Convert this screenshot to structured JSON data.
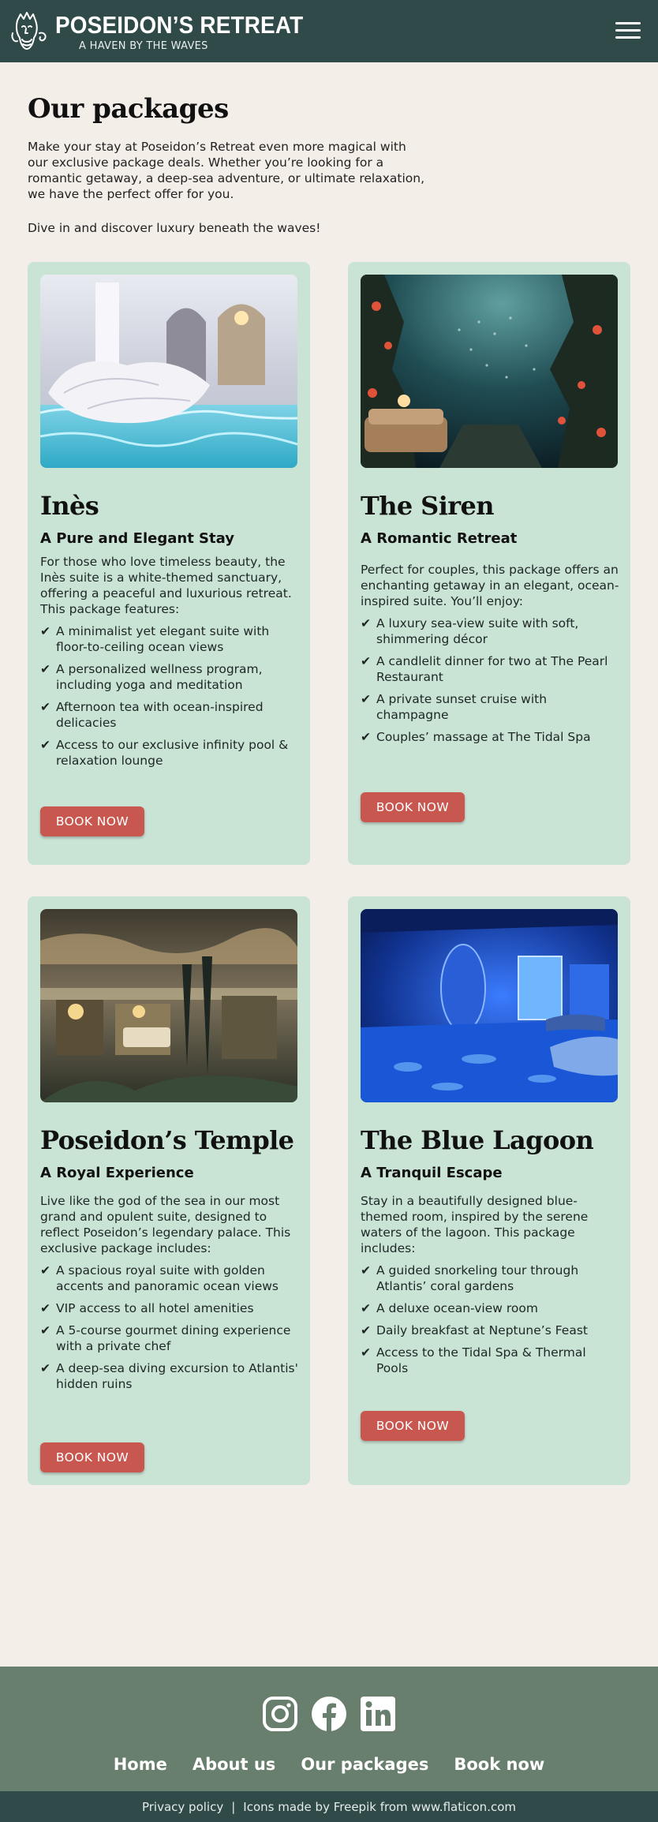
{
  "header": {
    "brand_name": "POSEIDON’S RETREAT",
    "tagline": "A HAVEN BY THE WAVES",
    "logo_icon": "poseidon-head-icon",
    "menu_icon": "hamburger-icon"
  },
  "intro": {
    "title": "Our packages",
    "text": "Make your stay at Poseidon’s Retreat even more magical with our exclusive package deals. Whether you’re looking for a romantic getaway, a deep-sea adventure, or ultimate relaxation, we have the perfect offer for you.",
    "cta": "Dive in and discover luxury beneath the waves!"
  },
  "packages": [
    {
      "name": "Inès",
      "subtitle": "A Pure and Elegant Stay",
      "description": "For those who love timeless beauty, the Inès suite is a white-themed sanctuary, offering a peaceful and luxurious retreat. This package features:",
      "features": [
        "A minimalist yet elegant suite with floor-to-ceiling ocean views",
        "A personalized wellness program, including yoga and meditation",
        "Afternoon tea with ocean-inspired delicacies",
        "Access to our exclusive infinity pool & relaxation lounge"
      ],
      "button": "BOOK NOW"
    },
    {
      "name": "The Siren",
      "subtitle": "A Romantic Retreat",
      "description": "Perfect for couples, this package offers an enchanting getaway in an elegant, ocean-inspired suite. You’ll enjoy:",
      "features": [
        "A luxury sea-view suite with soft, shimmering décor",
        "A candlelit dinner for two at The Pearl Restaurant",
        "A private sunset cruise with champagne",
        "Couples’ massage at The Tidal Spa"
      ],
      "button": "BOOK NOW"
    },
    {
      "name": "Poseidon’s Temple",
      "subtitle": "A Royal Experience",
      "description": "Live like the god of the sea in our most grand and opulent suite, designed to reflect Poseidon’s legendary palace. This exclusive package includes:",
      "features": [
        "A spacious royal suite with golden accents and panoramic ocean views",
        "VIP access to all hotel amenities",
        "A 5-course gourmet dining experience with a private chef",
        "A deep-sea diving excursion to Atlantis' hidden ruins"
      ],
      "button": "BOOK NOW"
    },
    {
      "name": "The Blue Lagoon",
      "subtitle": "A Tranquil Escape",
      "description": "Stay in a beautifully designed blue-themed room, inspired by the serene waters of the lagoon. This package includes:",
      "features": [
        "A guided snorkeling tour through Atlantis’ coral gardens",
        "A deluxe ocean-view room",
        "Daily breakfast at Neptune’s Feast",
        "Access to the Tidal Spa & Thermal Pools"
      ],
      "button": "BOOK NOW"
    }
  ],
  "check_mark": "✔",
  "footer": {
    "social_icons": [
      "instagram-icon",
      "facebook-icon",
      "linkedin-icon"
    ],
    "nav": [
      "Home",
      "About us",
      "Our packages",
      "Book now"
    ],
    "privacy": "Privacy policy",
    "separator": "|",
    "credits": "Icons made by Freepik from www.flaticon.com"
  },
  "colors": {
    "header_bg": "#2f4a48",
    "page_bg": "#f3eee8",
    "card_bg": "#c9e3d5",
    "button_bg": "#c85750",
    "footer_bg": "#687f6e"
  }
}
